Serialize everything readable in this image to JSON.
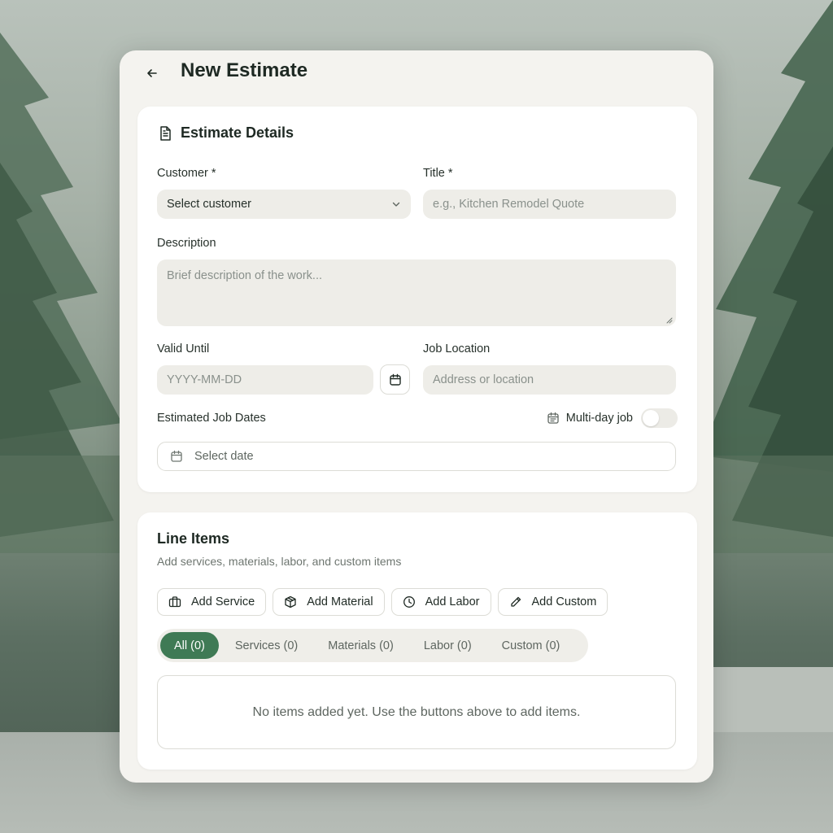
{
  "header": {
    "title": "New Estimate"
  },
  "details": {
    "title": "Estimate Details",
    "customer": {
      "label": "Customer *",
      "value": "Select customer"
    },
    "title_field": {
      "label": "Title *",
      "placeholder": "e.g., Kitchen Remodel Quote"
    },
    "description": {
      "label": "Description",
      "placeholder": "Brief description of the work..."
    },
    "valid_until": {
      "label": "Valid Until",
      "placeholder": "YYYY-MM-DD"
    },
    "job_location": {
      "label": "Job Location",
      "placeholder": "Address or location"
    },
    "job_dates": {
      "label": "Estimated Job Dates",
      "toggle_label": "Multi-day job",
      "toggle_on": false,
      "placeholder": "Select date"
    }
  },
  "line_items": {
    "title": "Line Items",
    "subtitle": "Add services, materials, labor, and custom items",
    "buttons": [
      "Add Service",
      "Add Material",
      "Add Labor",
      "Add Custom"
    ],
    "tabs": [
      "All (0)",
      "Services (0)",
      "Materials (0)",
      "Labor (0)",
      "Custom (0)"
    ],
    "active_tab": "All (0)",
    "empty_message": "No items added yet. Use the buttons above to add items."
  },
  "colors": {
    "accent": "#3f7a55",
    "card_bg": "#f4f3ef",
    "field_bg": "#eeede8"
  },
  "icons": [
    "back-arrow-icon",
    "document-icon",
    "chevron-down-icon",
    "calendar-icon",
    "briefcase-icon",
    "package-icon",
    "clock-icon",
    "pencil-icon"
  ]
}
